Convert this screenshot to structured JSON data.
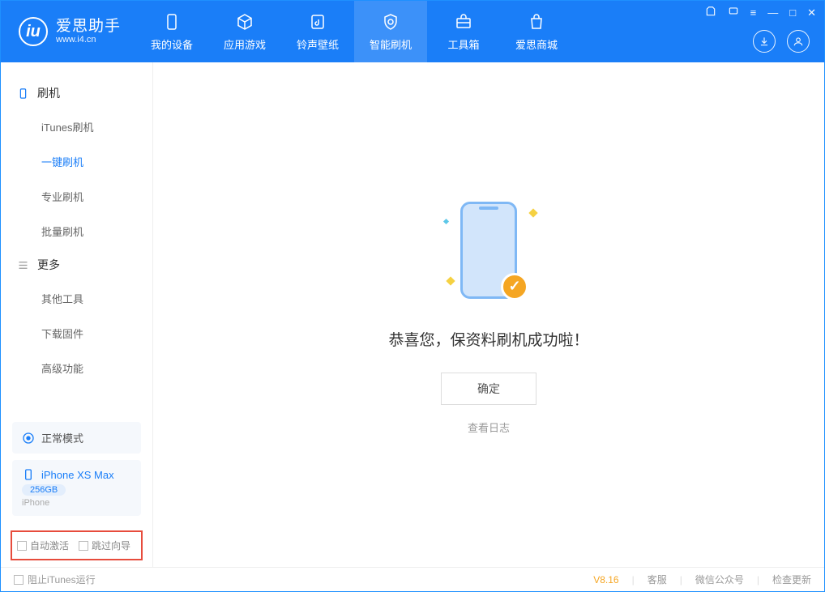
{
  "app": {
    "name_cn": "爱思助手",
    "url": "www.i4.cn"
  },
  "nav": [
    {
      "label": "我的设备"
    },
    {
      "label": "应用游戏"
    },
    {
      "label": "铃声壁纸"
    },
    {
      "label": "智能刷机"
    },
    {
      "label": "工具箱"
    },
    {
      "label": "爱思商城"
    }
  ],
  "sidebar": {
    "group1": {
      "title": "刷机",
      "items": [
        "iTunes刷机",
        "一键刷机",
        "专业刷机",
        "批量刷机"
      ],
      "active_index": 1
    },
    "group2": {
      "title": "更多",
      "items": [
        "其他工具",
        "下载固件",
        "高级功能"
      ]
    }
  },
  "device": {
    "mode": "正常模式",
    "name": "iPhone XS Max",
    "capacity": "256GB",
    "type": "iPhone"
  },
  "checkboxes": {
    "auto_activate": "自动激活",
    "skip_guide": "跳过向导"
  },
  "main": {
    "success_text": "恭喜您，保资料刷机成功啦！",
    "confirm": "确定",
    "view_log": "查看日志"
  },
  "footer": {
    "block_itunes": "阻止iTunes运行",
    "version": "V8.16",
    "support": "客服",
    "wechat": "微信公众号",
    "check_update": "检查更新"
  }
}
